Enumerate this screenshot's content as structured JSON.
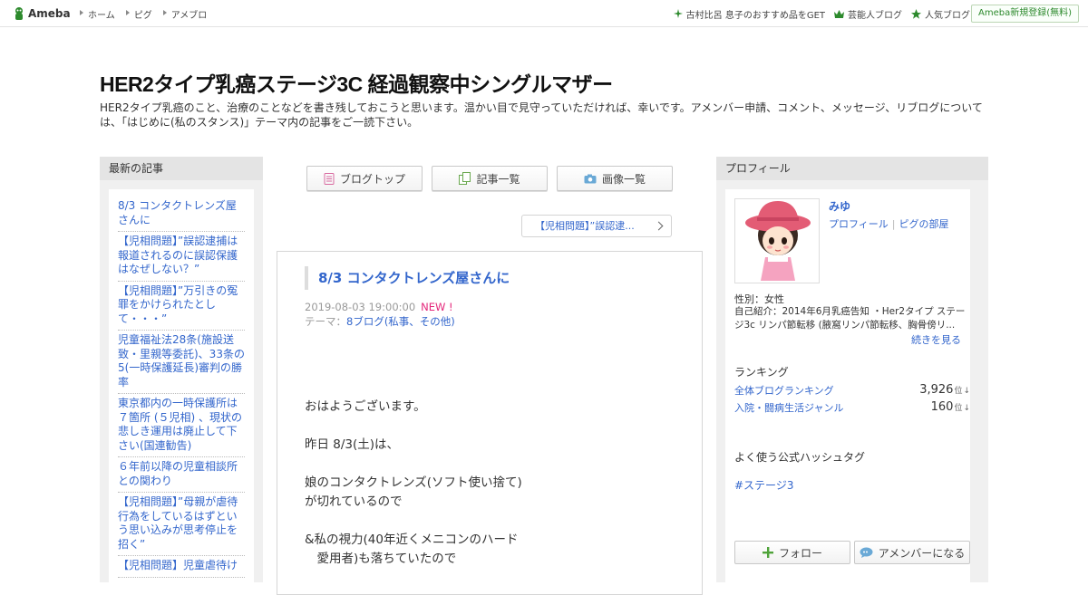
{
  "topbar": {
    "logo": "Ameba",
    "nav_left": [
      "ホーム",
      "ピグ",
      "アメブロ"
    ],
    "nav_right": [
      {
        "label": "古村比呂 息子のおすすめ品をGET",
        "icon": "sparkle-icon"
      },
      {
        "label": "芸能人ブログ",
        "icon": "crown-icon"
      },
      {
        "label": "人気ブログ",
        "icon": "star-icon"
      }
    ],
    "register": "Ameba新規登録(無料)"
  },
  "blog": {
    "title": "HER2タイプ乳癌ステージ3C 経過観察中シングルマザー",
    "description": "HER2タイプ乳癌のこと、治療のことなどを書き残しておこうと思います。温かい目で見守っていただければ、幸いです。アメンバー申請、コメント、メッセージ、リブログについては、「はじめに(私のスタンス)」テーマ内の記事をご一読下さい。"
  },
  "left": {
    "heading": "最新の記事",
    "items": [
      "8/3 コンタクトレンズ屋さんに",
      "【児相問題】”誤認逮捕は報道されるのに誤認保護はなぜしない？”",
      "【児相問題】”万引きの冤罪をかけられたとして・・・”",
      "児童福祉法28条(施設送致・里親等委託)、33条の5(一時保護延長)審判の勝率",
      "東京都内の一時保護所は７箇所 (５児相) 、現状の悲しき運用は廃止して下さい(国連勧告)",
      "６年前以降の児童相談所との関わり",
      "【児相問題】”母親が虐待行為をしているはずという思い込みが思考停止を招く”",
      "【児相問題】児童虐待け"
    ]
  },
  "tabs": [
    "ブログトップ",
    "記事一覧",
    "画像一覧"
  ],
  "next_article": "【児相問題】”誤認逮...",
  "article": {
    "title": "8/3 コンタクトレンズ屋さんに",
    "datetime": "2019-08-03 19:00:00",
    "new_badge": "NEW !",
    "theme_label": "テーマ：",
    "theme": "8ブログ(私事、その他)",
    "body": "おはようございます。\n\n昨日 8/3(土)は、\n\n娘のコンタクトレンズ(ソフト使い捨て)\nが切れているので\n\n&私の視力(40年近くメニコンのハード\n　愛用者)も落ちていたので"
  },
  "profile": {
    "heading": "プロフィール",
    "name": "みゆ",
    "link_profile": "プロフィール",
    "link_pigg": "ピグの部屋",
    "gender": "性別：女性",
    "intro": "自己紹介：2014年6月乳癌告知 ・Her2タイプ ステージ3c リンパ節転移 (腋窩リンパ節転移、胸骨傍リ...",
    "more": "続きを見る",
    "ranking_heading": "ランキング",
    "rankings": [
      {
        "name": "全体ブログランキング",
        "value": "3,926",
        "unit": "位"
      },
      {
        "name": "入院・闘病生活ジャンル",
        "value": "160",
        "unit": "位"
      }
    ],
    "hashtag_heading": "よく使う公式ハッシュタグ",
    "hashtag": "#ステージ3",
    "follow": "フォロー",
    "amember": "アメンバーになる"
  },
  "colors": {
    "link": "#3366cc",
    "new": "#e4267a",
    "ameba_green": "#2d8a2d"
  }
}
